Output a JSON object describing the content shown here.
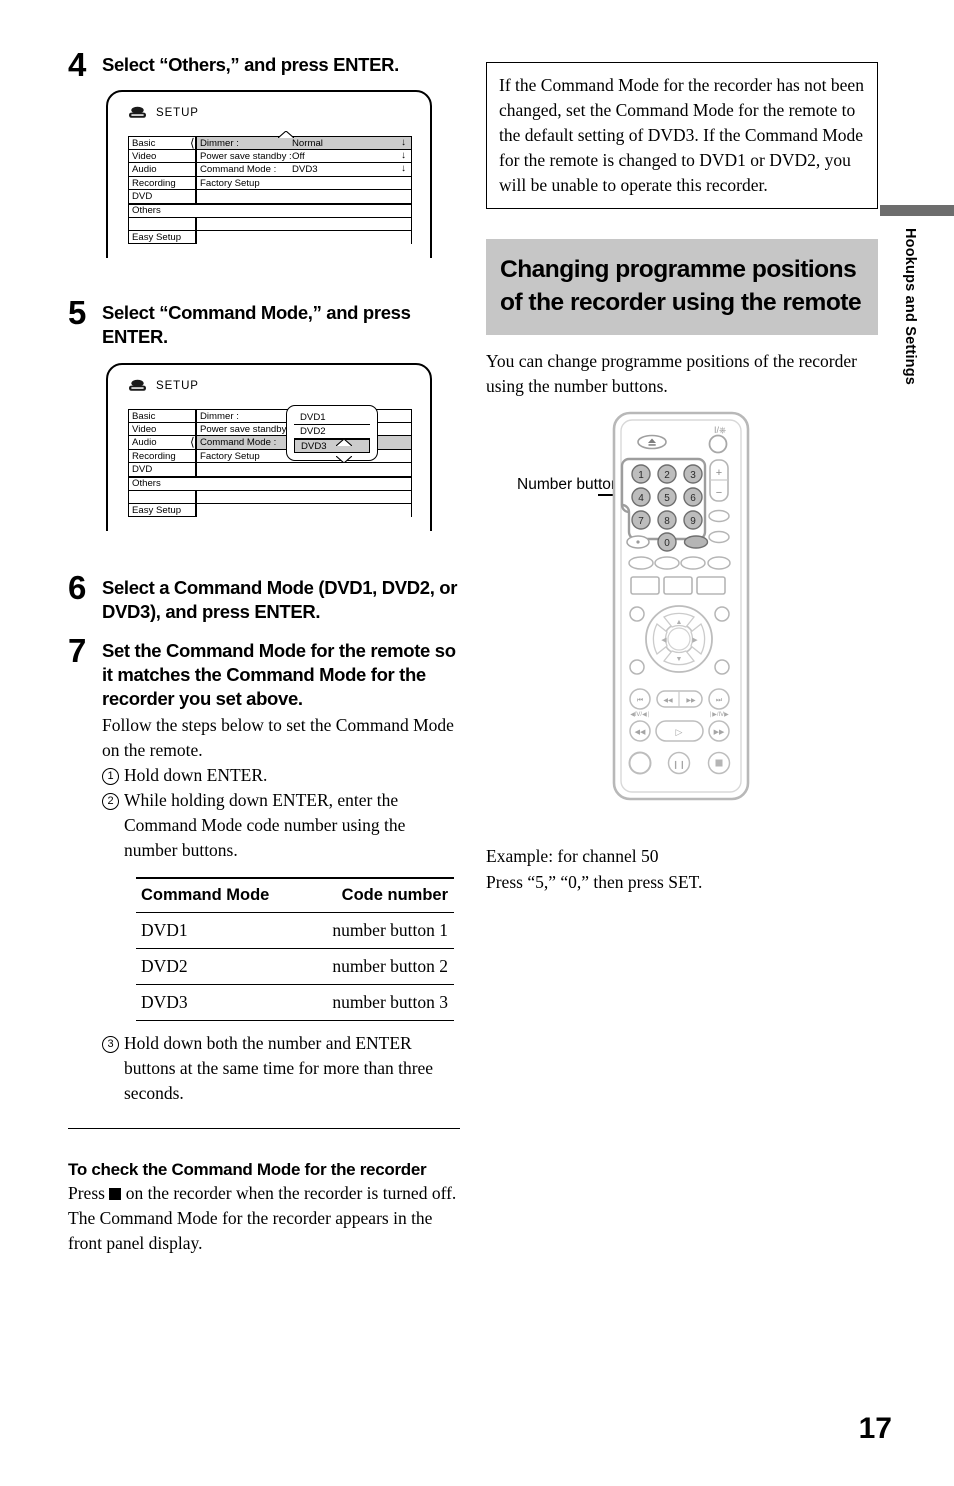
{
  "page": {
    "number": "17",
    "side_tab": "Hookups and Settings"
  },
  "steps": [
    {
      "num": "4",
      "title": "Select “Others,” and press ENTER."
    },
    {
      "num": "5",
      "title": "Select “Command Mode,” and press ENTER."
    },
    {
      "num": "6",
      "title": "Select a Command Mode (DVD1, DVD2, or DVD3), and press ENTER."
    },
    {
      "num": "7",
      "title": "Set the Command Mode for the remote so it matches the Command Mode for the recorder you set above.",
      "body": "Follow the steps below to set the Command Mode on the remote.",
      "items": [
        {
          "marker": "1",
          "text": "Hold down ENTER."
        },
        {
          "marker": "2",
          "text": "While holding down ENTER, enter the Command Mode code number using the number buttons."
        }
      ],
      "item3": {
        "marker": "3",
        "text": "Hold down both the number and ENTER buttons at the same time for more than three seconds."
      }
    }
  ],
  "osd1": {
    "title": "SETUP",
    "icon": "setup-disc-icon",
    "left_menu": [
      "Basic",
      "Video",
      "Audio",
      "Recording",
      "DVD",
      "Others",
      "",
      "Easy Setup"
    ],
    "rows": [
      {
        "label": "Dimmer :",
        "value": "Normal",
        "arrow": "↓",
        "selected": true
      },
      {
        "label": "Power save standby :",
        "value": "Off",
        "arrow": "↓",
        "selected": false
      },
      {
        "label": "Command Mode :",
        "value": "DVD3",
        "arrow": "↓",
        "selected": false
      },
      {
        "label": "Factory Setup",
        "value": "",
        "arrow": "",
        "selected": false
      },
      {
        "label": "",
        "value": "",
        "arrow": "",
        "selected": false
      }
    ],
    "highlight_left": "Others"
  },
  "osd2": {
    "title": "SETUP",
    "icon": "setup-disc-icon",
    "left_menu": [
      "Basic",
      "Video",
      "Audio",
      "Recording",
      "DVD",
      "Others",
      "",
      "Easy Setup"
    ],
    "rows": [
      {
        "label": "Dimmer :",
        "value": "",
        "arrow": "",
        "selected": false
      },
      {
        "label": "Power save standby",
        "value": "",
        "arrow": "",
        "selected": false
      },
      {
        "label": "Command Mode :",
        "value": "",
        "arrow": "",
        "selected": true
      },
      {
        "label": "Factory Setup",
        "value": "",
        "arrow": "",
        "selected": false
      },
      {
        "label": "",
        "value": "",
        "arrow": "",
        "selected": false
      }
    ],
    "popup_options": [
      "DVD1",
      "DVD2",
      "DVD3"
    ],
    "popup_selected": "DVD3",
    "highlight_left": "Others"
  },
  "table": {
    "headers": [
      "Command Mode",
      "Code number"
    ],
    "rows": [
      [
        "DVD1",
        "number button 1"
      ],
      [
        "DVD2",
        "number button 2"
      ],
      [
        "DVD3",
        "number button 3"
      ]
    ]
  },
  "check_section": {
    "heading": "To check the Command Mode for the recorder",
    "text_before": "Press ",
    "text_after": " on the recorder when the recorder is turned off. The Command Mode for the recorder appears in the front panel display."
  },
  "note": {
    "text": "If the Command Mode for the recorder has not been changed, set the Command Mode for the remote to the default setting of DVD3. If the Command Mode for the remote is changed to DVD1 or DVD2, you will be unable to operate this recorder."
  },
  "section": {
    "heading": "Changing programme positions of the recorder using the remote",
    "intro": "You can change programme positions of the recorder using the number buttons.",
    "callout": "Number buttons, SET",
    "example_line1": "Example: for channel 50",
    "example_line2": "Press “5,” “0,” then press SET."
  },
  "remote": {
    "number_keys": [
      "1",
      "2",
      "3",
      "4",
      "5",
      "6",
      "7",
      "8",
      "9",
      "0"
    ],
    "power_label": "I/⏻"
  }
}
